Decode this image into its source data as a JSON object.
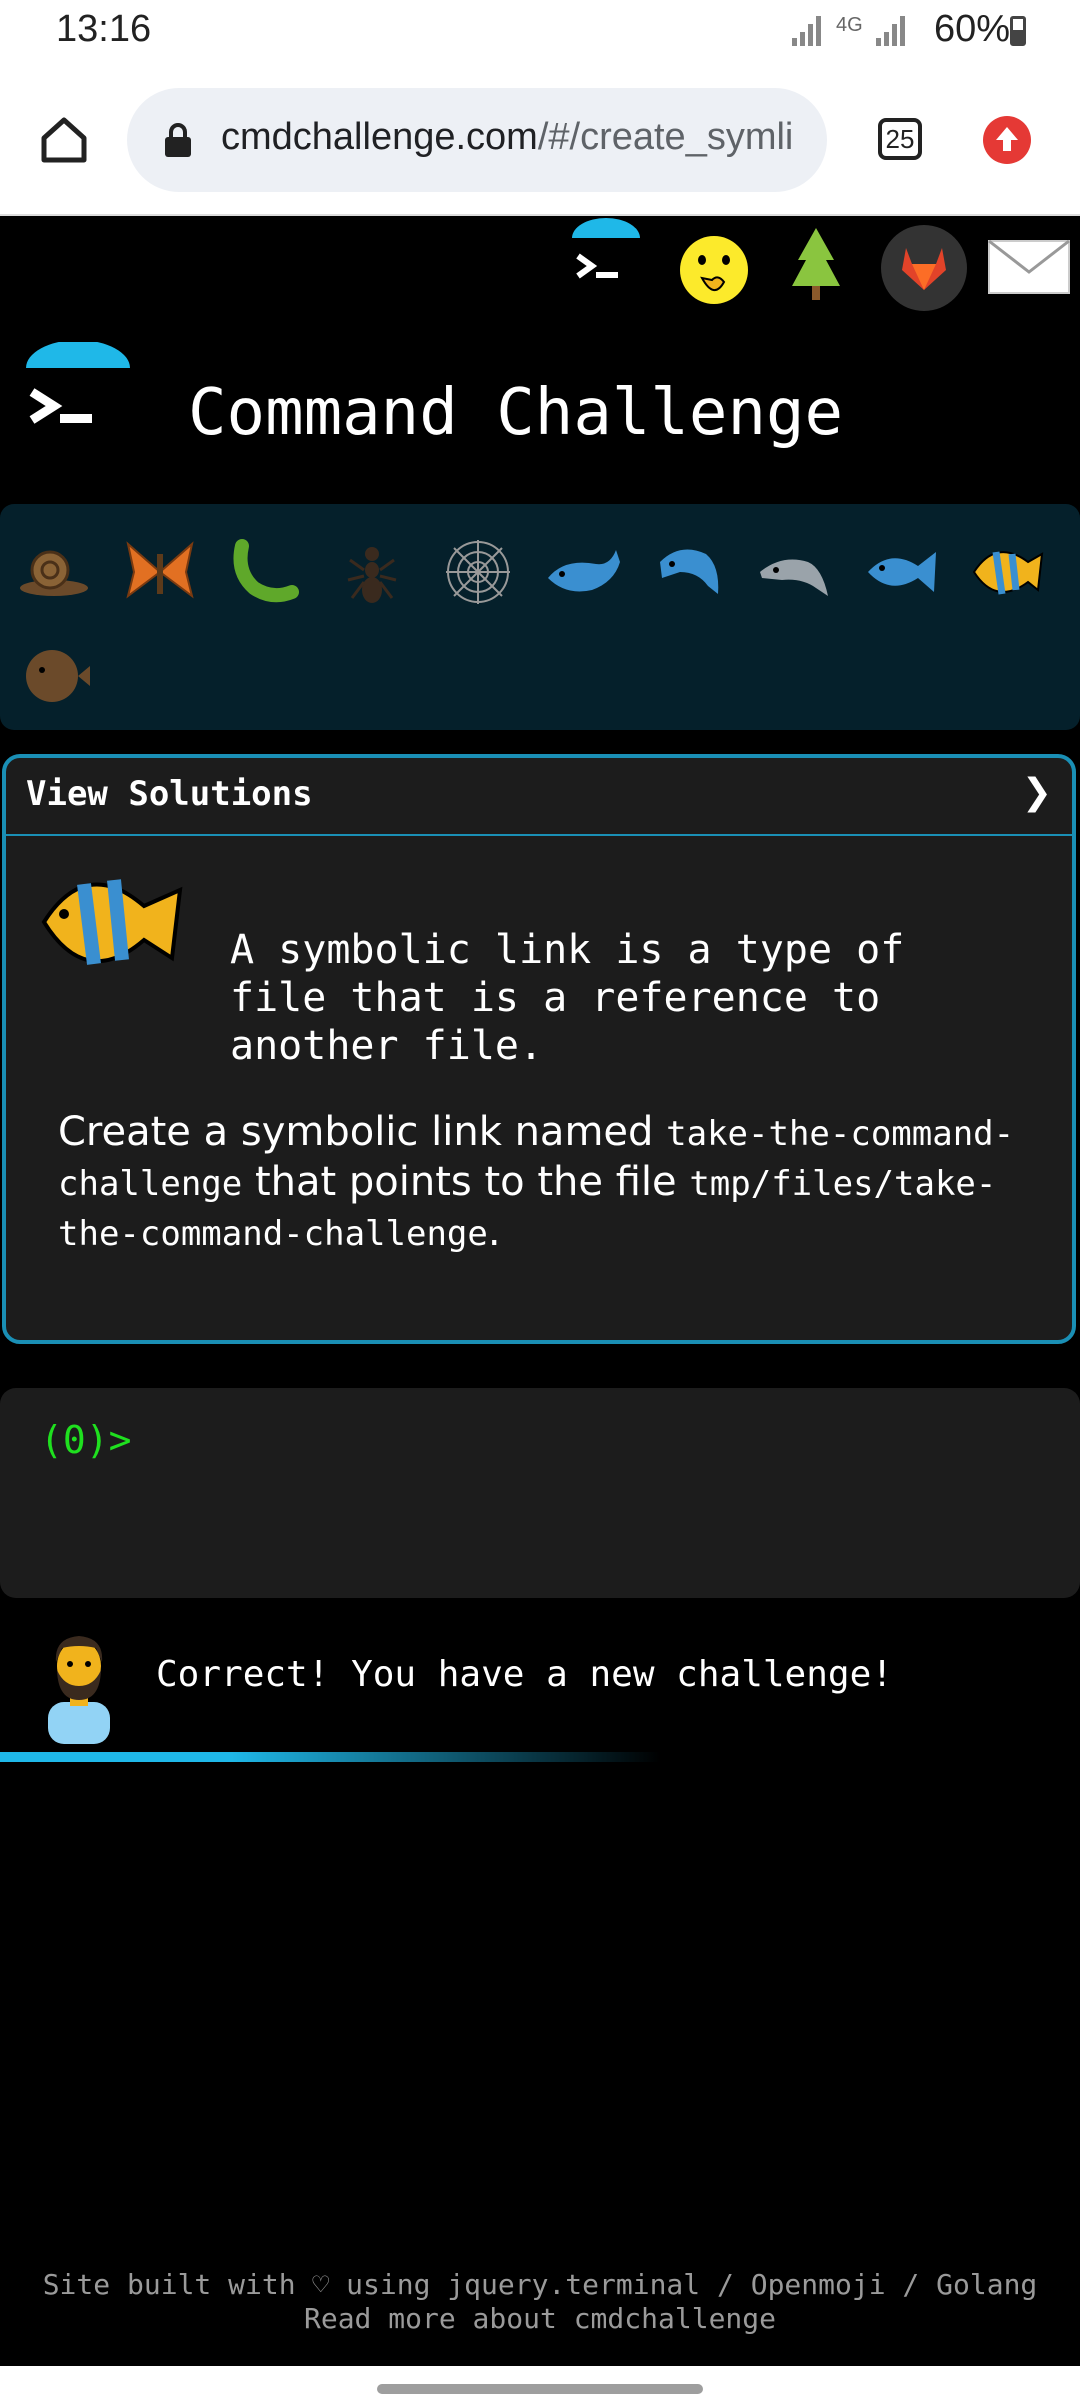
{
  "status_bar": {
    "time": "13:16",
    "network": "4G",
    "battery": "60%"
  },
  "browser": {
    "url_host": "cmdchallenge.com",
    "url_path": "/#/create_symli",
    "tab_count": "25"
  },
  "site": {
    "title": "Command Challenge"
  },
  "header_icons": [
    "terminal-icon",
    "shushing-face-icon",
    "tree-icon",
    "gitlab-icon",
    "envelope-icon"
  ],
  "emoji_levels": [
    "snail-icon",
    "butterfly-icon",
    "caterpillar-icon",
    "ant-icon",
    "spider-web-icon",
    "whale-icon",
    "dolphin-icon",
    "dolphin-grey-icon",
    "fish-icon",
    "tropical-fish-icon",
    "blowfish-icon"
  ],
  "challenge": {
    "solutions_label": "View Solutions",
    "chevron": "❯",
    "intro": "A symbolic link is a type of file that is a reference to another file.",
    "task_part1": "Create a symbolic link named ",
    "task_code1": "take-the-command-challenge",
    "task_part2": " that points to the file ",
    "task_code2": "tmp/files/take-the-command-challenge",
    "task_part3": "."
  },
  "terminal": {
    "prompt": "(0)>"
  },
  "message": {
    "text": "Correct! You have a new challenge!"
  },
  "footer": {
    "line1": "Site built with ♡ using jquery.terminal / Openmoji / Golang",
    "line2": "Read more about cmdchallenge"
  },
  "colors": {
    "accent": "#1fb8e8",
    "prompt_green": "#1fe01f",
    "panel": "#1c1c1c",
    "emoji_bar": "#05202b"
  }
}
